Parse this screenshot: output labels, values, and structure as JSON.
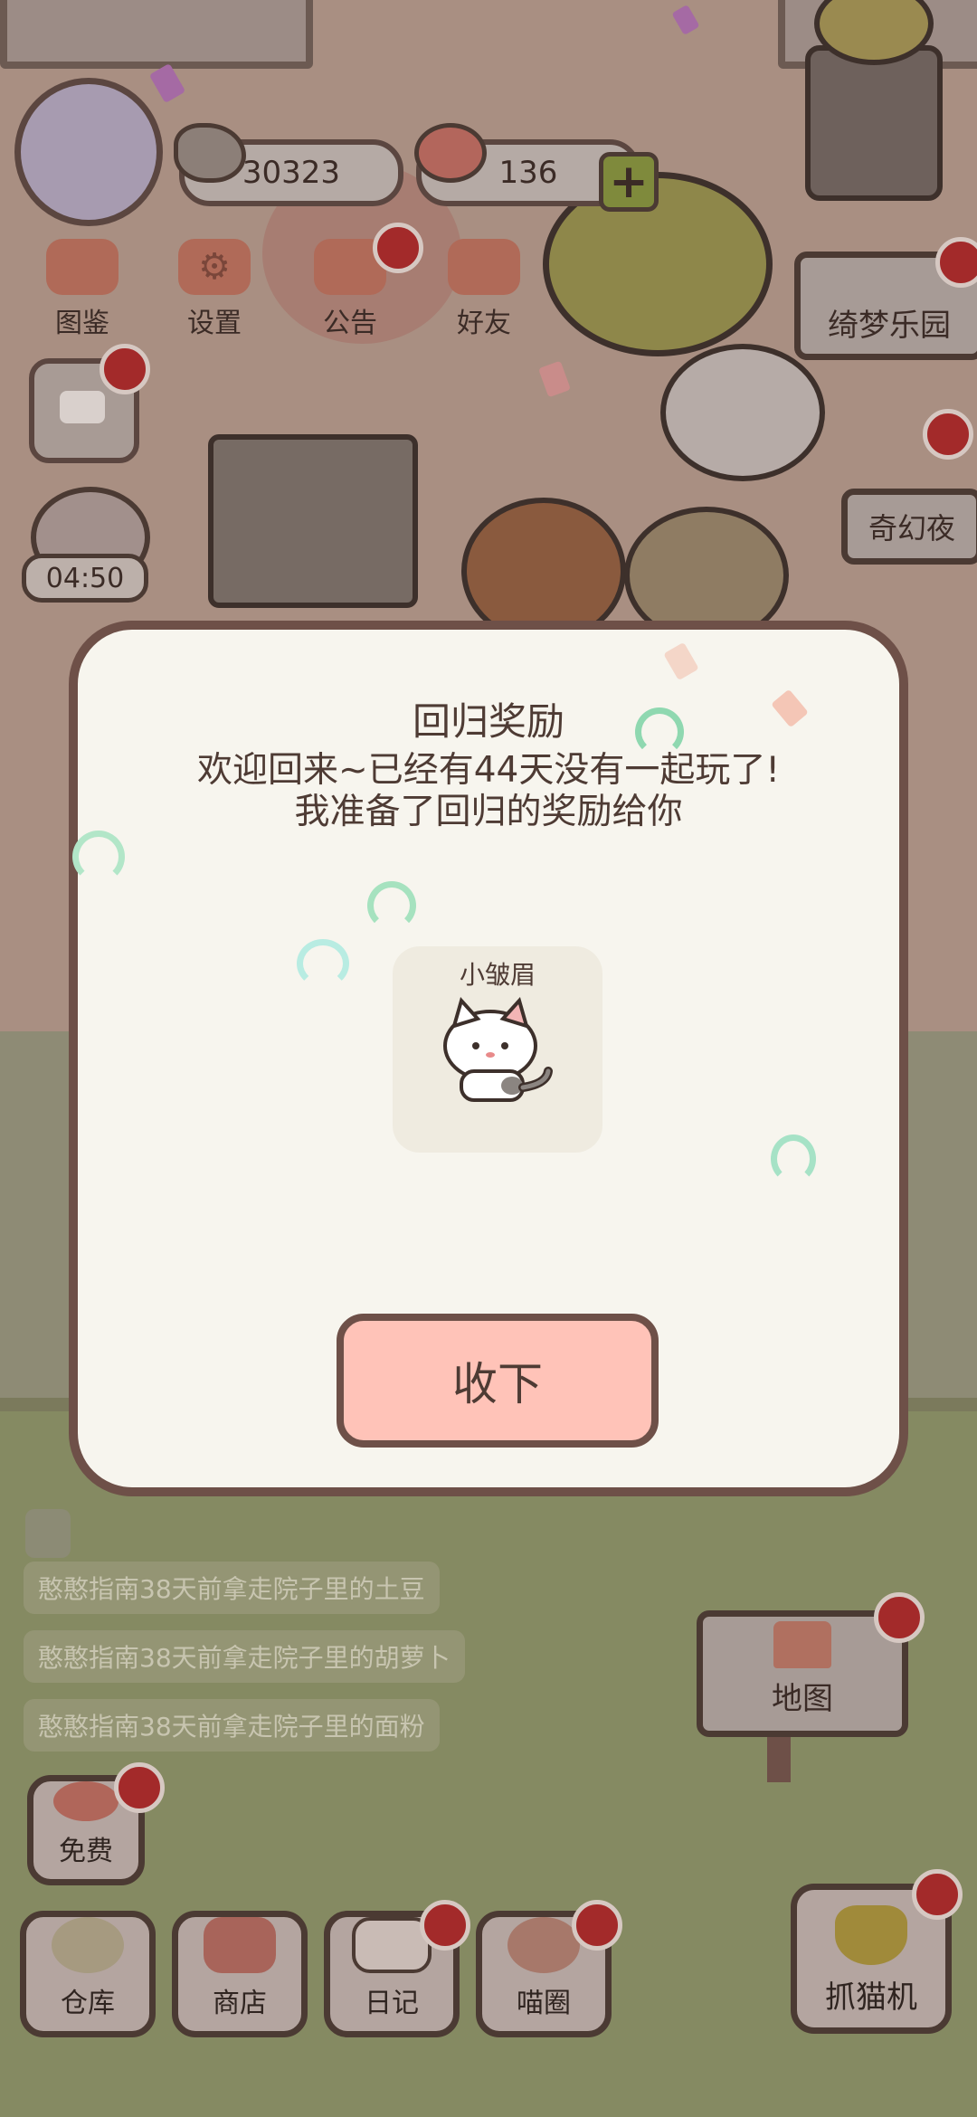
{
  "resources": {
    "fish": "30323",
    "hearts": "136"
  },
  "top_menu": [
    {
      "label": "图鉴",
      "icon": "cat-book-icon"
    },
    {
      "label": "设置",
      "icon": "gear-icon"
    },
    {
      "label": "公告",
      "icon": "gift-icon"
    },
    {
      "label": "好友",
      "icon": "friends-icon"
    }
  ],
  "timer": "04:50",
  "event_signs": {
    "park": "绮梦乐园",
    "night": "奇幻夜"
  },
  "modal": {
    "title": "回归奖励",
    "line1": "欢迎回来~已经有44天没有一起玩了!",
    "line2": "我准备了回归的奖励给你",
    "reward_name": "小皱眉",
    "accept_label": "收下"
  },
  "feed": [
    "憨憨指南38天前拿走院子里的土豆",
    "憨憨指南38天前拿走院子里的胡萝卜",
    "憨憨指南38天前拿走院子里的面粉"
  ],
  "map_label": "地图",
  "free_label": "免费",
  "bottom_nav": [
    {
      "label": "仓库",
      "icon": "warehouse-icon"
    },
    {
      "label": "商店",
      "icon": "shop-icon"
    },
    {
      "label": "日记",
      "icon": "diary-icon"
    },
    {
      "label": "喵圈",
      "icon": "cat-circle-icon"
    }
  ],
  "claw_label": "抓猫机",
  "colors": {
    "modal_bg": "#f7f5ee",
    "accept_button": "#ffc3b8",
    "notification": "#a32a2a"
  }
}
